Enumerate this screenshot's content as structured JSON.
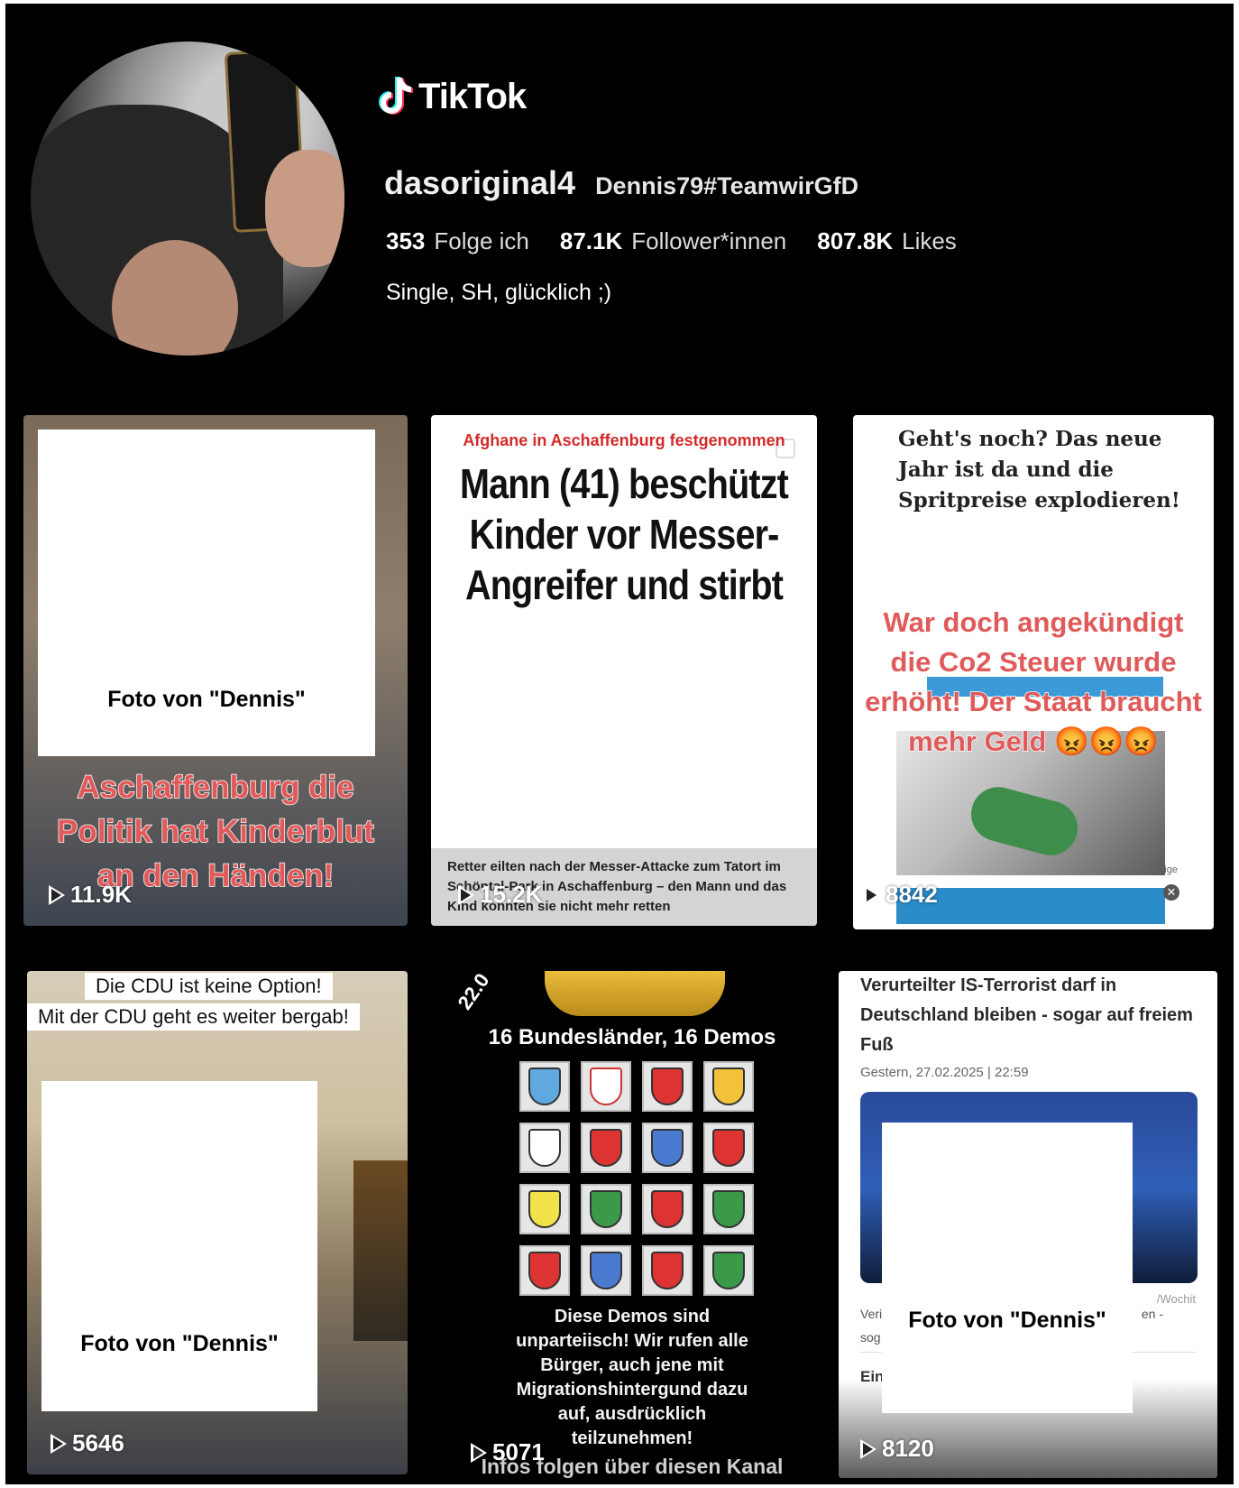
{
  "brand": {
    "name": "TikTok",
    "icon": "tiktok-note-icon"
  },
  "profile": {
    "username": "dasoriginal4",
    "nickname": "Dennis79#TeamwirGfD",
    "bio": "Single, SH, glücklich ;)",
    "stats": [
      {
        "value": "353",
        "label": "Folge ich"
      },
      {
        "value": "87.1K",
        "label": "Follower*innen"
      },
      {
        "value": "807.8K",
        "label": "Likes"
      }
    ]
  },
  "videos": [
    {
      "views": "11.9K",
      "photo_label": "Foto von \"Dennis\"",
      "overlay_lines": [
        "Aschaffenburg die",
        "Politik hat Kinderblut",
        "an den Händen!"
      ]
    },
    {
      "views": "15.2K",
      "kicker": "Afghane in Aschaffenburg festgenommen",
      "headline": [
        "Mann (41) beschützt",
        "Kinder vor Messer-",
        "Angreifer und stirbt"
      ],
      "caption": [
        "Retter eilten nach der Messer-Attacke zum Tatort im",
        "Schöntal-Park in Aschaffenburg – den Mann und das",
        "Kind konnten sie nicht mehr retten"
      ]
    },
    {
      "views": "8842",
      "quote": "Geht's noch? Das neue Jahr ist da und die Spritpreise explodieren!",
      "overlay_lines": [
        "War doch angekündigt",
        "die Co2 Steuer wurde",
        "erhöht! Der Staat braucht",
        "mehr Geld 😡😡😡"
      ],
      "ad_label": "Anzeige",
      "ad_close": "✕"
    },
    {
      "views": "5646",
      "caption_lines": [
        "Die CDU ist keine Option!",
        "Mit der CDU geht es weiter bergab!"
      ],
      "photo_label": "Foto von \"Dennis\""
    },
    {
      "views": "5071",
      "date_fragment": "22.0",
      "heading": "16 Bundesländer, 16 Demos",
      "body": [
        "Diese Demos sind",
        "unparteiisch! Wir rufen alle",
        "Bürger, auch jene mit",
        "Migrationshintergund dazu",
        "auf, ausdrücklich",
        "teilzunehmen!"
      ],
      "footer": "Infos folgen über diesen Kanal"
    },
    {
      "views": "8120",
      "title": "Verurteilter IS-Terrorist darf in Deutschland bleiben - sogar auf freiem Fuß",
      "meta": "Gestern, 27.02.2025 | 22:59",
      "hero_tail": "/Wochit",
      "frag_a": "Veri",
      "frag_b": "sog",
      "frag_c": "en -",
      "frag_d": "Ein",
      "photo_label": "Foto von \"Dennis\""
    }
  ],
  "colors": {
    "background": "#000000",
    "overlay_red": "#e05a5a",
    "kicker_red": "#d42a2a"
  }
}
